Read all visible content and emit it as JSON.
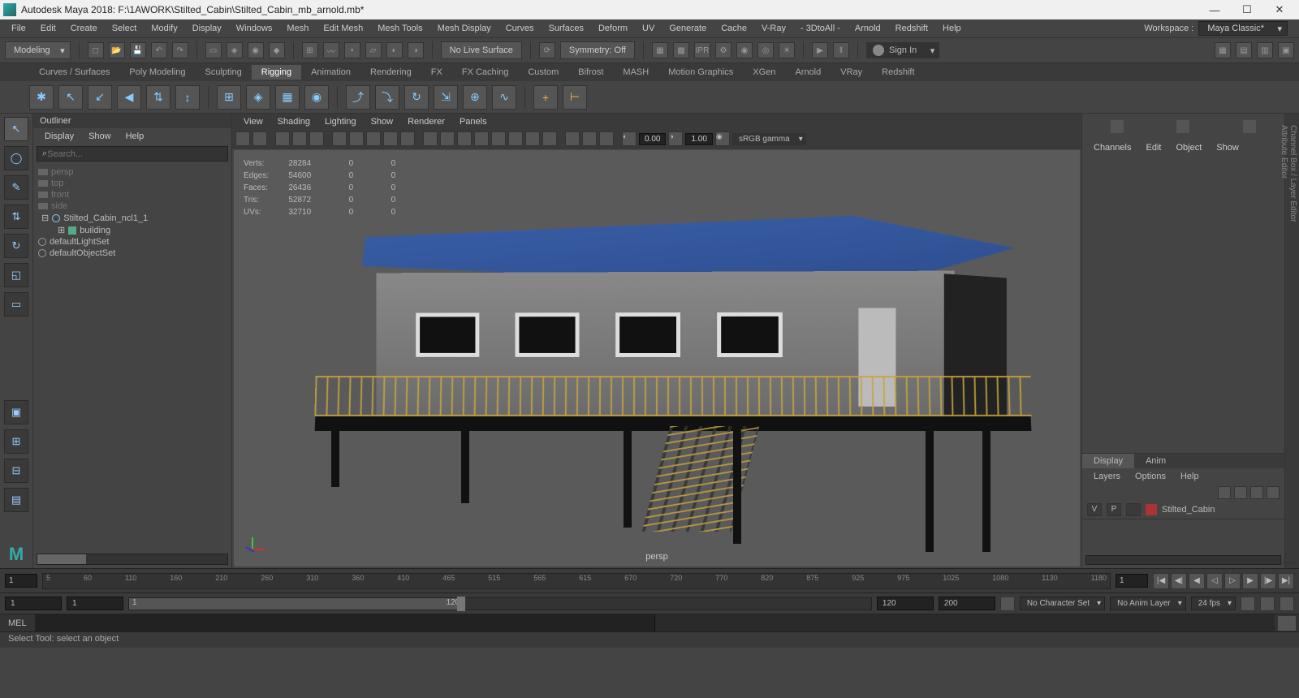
{
  "title": "Autodesk Maya 2018: F:\\1AWORK\\Stilted_Cabin\\Stilted_Cabin_mb_arnold.mb*",
  "menus": [
    "File",
    "Edit",
    "Create",
    "Select",
    "Modify",
    "Display",
    "Windows",
    "Mesh",
    "Edit Mesh",
    "Mesh Tools",
    "Mesh Display",
    "Curves",
    "Surfaces",
    "Deform",
    "UV",
    "Generate",
    "Cache",
    "V-Ray",
    "- 3DtoAll -",
    "Arnold",
    "Redshift",
    "Help"
  ],
  "workspace": {
    "label": "Workspace :",
    "value": "Maya Classic*"
  },
  "modeDropdown": "Modeling",
  "liveSurface": "No Live Surface",
  "symmetry": "Symmetry: Off",
  "signIn": "Sign In",
  "shelfTabs": [
    "Curves / Surfaces",
    "Poly Modeling",
    "Sculpting",
    "Rigging",
    "Animation",
    "Rendering",
    "FX",
    "FX Caching",
    "Custom",
    "Bifrost",
    "MASH",
    "Motion Graphics",
    "XGen",
    "Arnold",
    "VRay",
    "Redshift"
  ],
  "activeShelf": "Rigging",
  "outliner": {
    "title": "Outliner",
    "menus": [
      "Display",
      "Show",
      "Help"
    ],
    "searchPlaceholder": "Search...",
    "items": [
      {
        "label": "persp",
        "type": "cam",
        "dim": true
      },
      {
        "label": "top",
        "type": "cam",
        "dim": true
      },
      {
        "label": "front",
        "type": "cam",
        "dim": true
      },
      {
        "label": "side",
        "type": "cam",
        "dim": true
      },
      {
        "label": "Stilted_Cabin_ncl1_1",
        "type": "group",
        "indent": 0
      },
      {
        "label": "building",
        "type": "mesh",
        "indent": 1
      },
      {
        "label": "defaultLightSet",
        "type": "set",
        "indent": 0
      },
      {
        "label": "defaultObjectSet",
        "type": "set",
        "indent": 0
      }
    ]
  },
  "viewportMenus": [
    "View",
    "Shading",
    "Lighting",
    "Show",
    "Renderer",
    "Panels"
  ],
  "viewportTools": {
    "val1": "0.00",
    "val2": "1.00",
    "colorspace": "sRGB gamma"
  },
  "hud": {
    "rows": [
      {
        "label": "Verts:",
        "v1": "28284",
        "v2": "0",
        "v3": "0"
      },
      {
        "label": "Edges:",
        "v1": "54600",
        "v2": "0",
        "v3": "0"
      },
      {
        "label": "Faces:",
        "v1": "26436",
        "v2": "0",
        "v3": "0"
      },
      {
        "label": "Tris:",
        "v1": "52872",
        "v2": "0",
        "v3": "0"
      },
      {
        "label": "UVs:",
        "v1": "32710",
        "v2": "0",
        "v3": "0"
      }
    ]
  },
  "cameraLabel": "persp",
  "channelBox": {
    "menus": [
      "Channels",
      "Edit",
      "Object",
      "Show"
    ]
  },
  "layerPanel": {
    "tabs": [
      "Display",
      "Anim"
    ],
    "activeTab": "Display",
    "menus": [
      "Layers",
      "Options",
      "Help"
    ],
    "layer": {
      "v": "V",
      "p": "P",
      "name": "Stilted_Cabin"
    }
  },
  "rightTabs": [
    "Channel Box / Layer Editor",
    "Attribute Editor"
  ],
  "timeline": {
    "start": "1",
    "ticks": [
      "5",
      "60",
      "110",
      "160",
      "210",
      "260",
      "310",
      "360",
      "410",
      "465",
      "515",
      "565",
      "615",
      "670",
      "720",
      "770",
      "820",
      "875",
      "925",
      "975",
      "1025",
      "1080",
      "1130",
      "1180"
    ],
    "end": "1"
  },
  "range": {
    "rangeStart": "1",
    "playStart": "1",
    "playbackStart": "1",
    "playbackEnd": "120",
    "rangePlayEnd": "120",
    "rangeEnd": "200",
    "charSet": "No Character Set",
    "animLayer": "No Anim Layer",
    "fps": "24 fps"
  },
  "cmd": {
    "label": "MEL"
  },
  "helpLine": "Select Tool: select an object"
}
